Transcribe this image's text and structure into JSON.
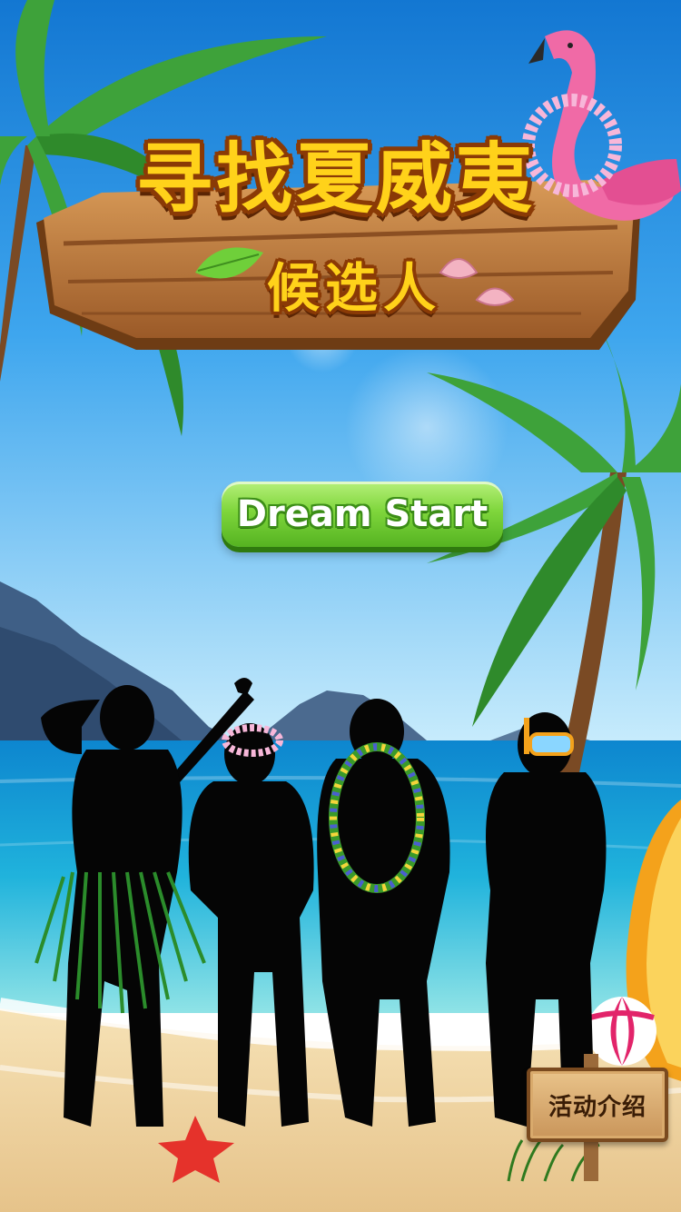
{
  "game": {
    "title_main": "寻找夏威夷",
    "title_sub": "候选人",
    "start_button_label": "Dream Start",
    "info_button_label": "活动介绍"
  },
  "icons": {
    "title_sign": "wooden-title-sign",
    "leaf": "green-leaf-icon",
    "seashells": "seashell-icon",
    "flamingo": "flamingo-icon",
    "palm_trees": "palm-tree-icon",
    "silhouettes": "man-silhouette-icon",
    "flower_lei": "flower-lei-icon",
    "snorkel": "snorkel-mask-icon",
    "starfish": "starfish-icon",
    "beach_ball": "beach-ball-icon",
    "surfboard": "surfboard-icon",
    "guitar": "guitar-icon"
  },
  "colors": {
    "sky_top": "#1f8fe0",
    "sky_bottom": "#bfe7fb",
    "sea": "#1fa9d6",
    "sand": "#f0d6a4",
    "wood": "#b2703a",
    "title_yellow": "#ffd21a",
    "button_green": "#7fd63c"
  }
}
